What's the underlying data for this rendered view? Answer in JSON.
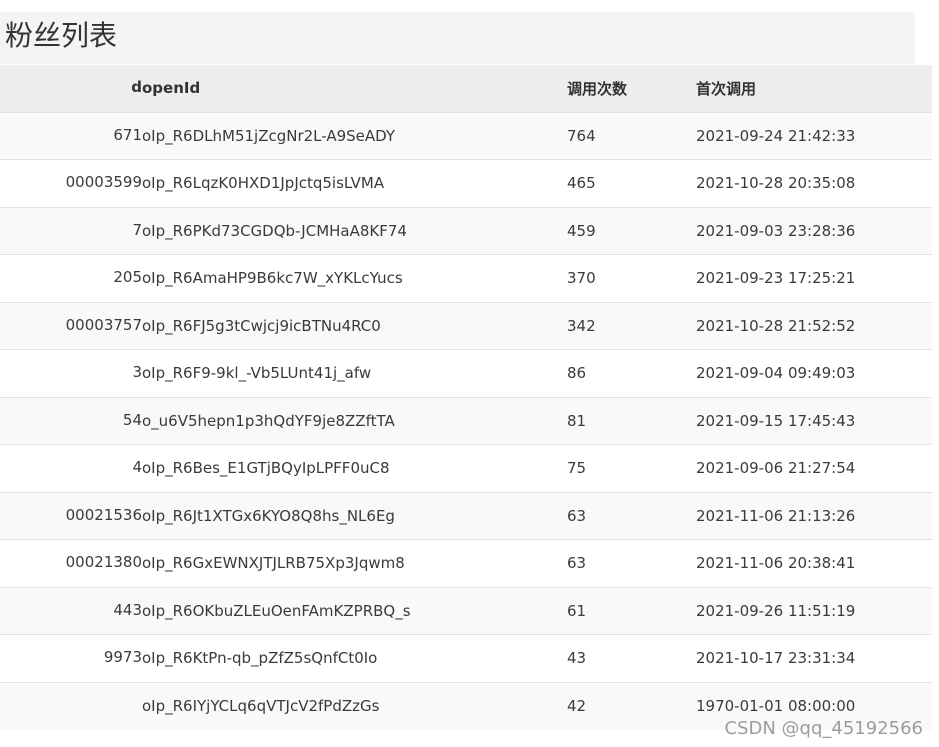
{
  "header": {
    "title": "粉丝列表"
  },
  "table": {
    "columns": [
      {
        "key": "id",
        "label": "d"
      },
      {
        "key": "openId",
        "label": "openId"
      },
      {
        "key": "calls",
        "label": "调用次数"
      },
      {
        "key": "first",
        "label": "首次调用"
      }
    ],
    "rows": [
      {
        "id": "671",
        "openId": "oIp_R6DLhM51jZcgNr2L-A9SeADY",
        "calls": "764",
        "first": "2021-09-24 21:42:33"
      },
      {
        "id": "00003599",
        "openId": "oIp_R6LqzK0HXD1JpJctq5isLVMA",
        "calls": "465",
        "first": "2021-10-28 20:35:08"
      },
      {
        "id": "7",
        "openId": "oIp_R6PKd73CGDQb-JCMHaA8KF74",
        "calls": "459",
        "first": "2021-09-03 23:28:36"
      },
      {
        "id": "205",
        "openId": "oIp_R6AmaHP9B6kc7W_xYKLcYucs",
        "calls": "370",
        "first": "2021-09-23 17:25:21"
      },
      {
        "id": "00003757",
        "openId": "oIp_R6FJ5g3tCwjcj9icBTNu4RC0",
        "calls": "342",
        "first": "2021-10-28 21:52:52"
      },
      {
        "id": "3",
        "openId": "oIp_R6F9-9kl_-Vb5LUnt41j_afw",
        "calls": "86",
        "first": "2021-09-04 09:49:03"
      },
      {
        "id": "54",
        "openId": "o_u6V5hepn1p3hQdYF9je8ZZftTA",
        "calls": "81",
        "first": "2021-09-15 17:45:43"
      },
      {
        "id": "4",
        "openId": "oIp_R6Bes_E1GTjBQyIpLPFF0uC8",
        "calls": "75",
        "first": "2021-09-06 21:27:54"
      },
      {
        "id": "00021536",
        "openId": "oIp_R6Jt1XTGx6KYO8Q8hs_NL6Eg",
        "calls": "63",
        "first": "2021-11-06 21:13:26"
      },
      {
        "id": "00021380",
        "openId": "oIp_R6GxEWNXJTJLRB75Xp3Jqwm8",
        "calls": "63",
        "first": "2021-11-06 20:38:41"
      },
      {
        "id": "443",
        "openId": "oIp_R6OKbuZLEuOenFAmKZPRBQ_s",
        "calls": "61",
        "first": "2021-09-26 11:51:19"
      },
      {
        "id": "9973",
        "openId": "oIp_R6KtPn-qb_pZfZ5sQnfCt0Io",
        "calls": "43",
        "first": "2021-10-17 23:31:34"
      },
      {
        "id": "",
        "openId": "oIp_R6IYjYCLq6qVTJcV2fPdZzGs",
        "calls": "42",
        "first": "1970-01-01 08:00:00"
      }
    ]
  },
  "watermark": "CSDN @qq_45192566"
}
